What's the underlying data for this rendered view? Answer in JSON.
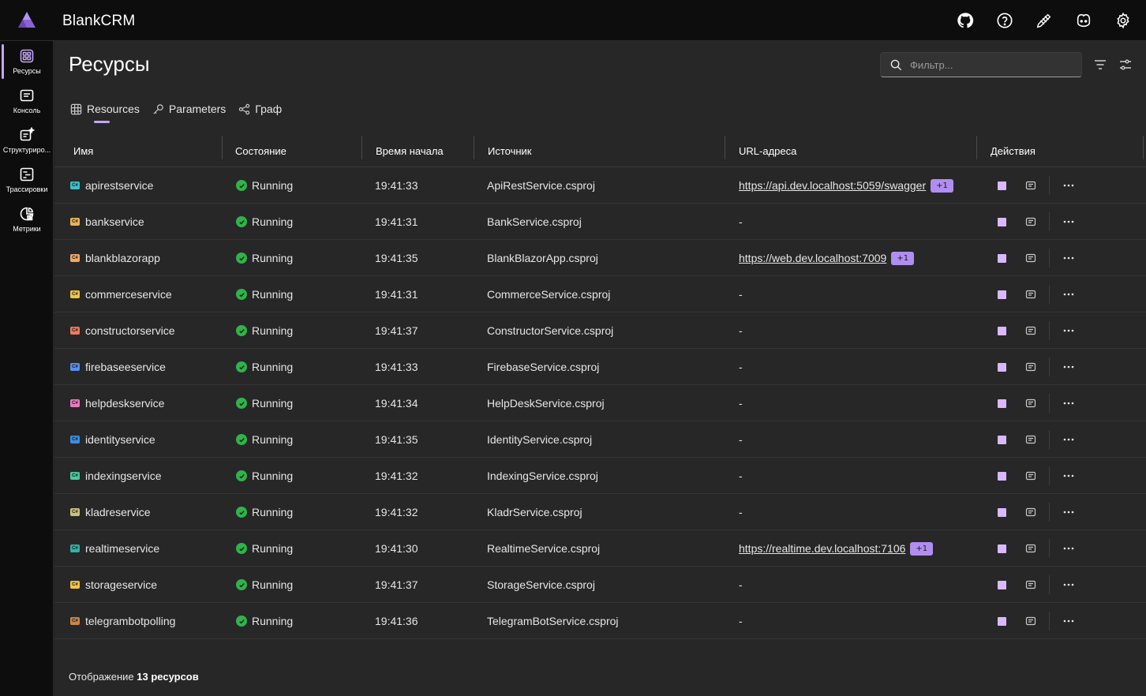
{
  "app": {
    "title": "BlankCRM"
  },
  "nav": [
    {
      "label": "Ресурсы",
      "icon": "grid-icon",
      "active": true
    },
    {
      "label": "Консоль",
      "icon": "console-icon"
    },
    {
      "label": "Структуриро...",
      "icon": "structured-logs-icon"
    },
    {
      "label": "Трассировки",
      "icon": "traces-icon"
    },
    {
      "label": "Метрики",
      "icon": "metrics-icon"
    }
  ],
  "header_icons": [
    "github-icon",
    "help-icon",
    "feedback-icon",
    "copilot-icon",
    "settings-icon"
  ],
  "page": {
    "title": "Ресурсы",
    "filter_placeholder": "Фильтр..."
  },
  "tabs": [
    {
      "label": "Resources",
      "icon": "table-icon",
      "active": true
    },
    {
      "label": "Parameters",
      "icon": "key-icon"
    },
    {
      "label": "Граф",
      "icon": "graph-icon"
    }
  ],
  "columns": {
    "name": "Имя",
    "state": "Состояние",
    "start": "Время начала",
    "source": "Источник",
    "urls": "URL-адреса",
    "actions": "Действия"
  },
  "rows": [
    {
      "name": "apirestservice",
      "color": "#3cc2c9",
      "state": "Running",
      "start": "19:41:33",
      "source": "ApiRestService.csproj",
      "url": "https://api.dev.localhost:5059/swagger",
      "extra": "+1"
    },
    {
      "name": "bankservice",
      "color": "#e8b35a",
      "state": "Running",
      "start": "19:41:31",
      "source": "BankService.csproj",
      "url": "-",
      "extra": ""
    },
    {
      "name": "blankblazorapp",
      "color": "#f0a86a",
      "state": "Running",
      "start": "19:41:35",
      "source": "BlankBlazorApp.csproj",
      "url": "https://web.dev.localhost:7009",
      "extra": "+1"
    },
    {
      "name": "commerceservice",
      "color": "#f5c542",
      "state": "Running",
      "start": "19:41:31",
      "source": "CommerceService.csproj",
      "url": "-",
      "extra": ""
    },
    {
      "name": "constructorservice",
      "color": "#f07a5a",
      "state": "Running",
      "start": "19:41:37",
      "source": "ConstructorService.csproj",
      "url": "-",
      "extra": ""
    },
    {
      "name": "firebaseeservice",
      "color": "#5a8ff0",
      "state": "Running",
      "start": "19:41:33",
      "source": "FirebaseService.csproj",
      "url": "-",
      "extra": ""
    },
    {
      "name": "helpdeskservice",
      "color": "#e87ac0",
      "state": "Running",
      "start": "19:41:34",
      "source": "HelpDeskService.csproj",
      "url": "-",
      "extra": ""
    },
    {
      "name": "identityservice",
      "color": "#3a8ee6",
      "state": "Running",
      "start": "19:41:35",
      "source": "IdentityService.csproj",
      "url": "-",
      "extra": ""
    },
    {
      "name": "indexingservice",
      "color": "#4cc9a0",
      "state": "Running",
      "start": "19:41:32",
      "source": "IndexingService.csproj",
      "url": "-",
      "extra": ""
    },
    {
      "name": "kladreservice",
      "color": "#c8c27a",
      "state": "Running",
      "start": "19:41:32",
      "source": "KladrService.csproj",
      "url": "-",
      "extra": ""
    },
    {
      "name": "realtimeservice",
      "color": "#2fb3a8",
      "state": "Running",
      "start": "19:41:30",
      "source": "RealtimeService.csproj",
      "url": "https://realtime.dev.localhost:7106",
      "extra": "+1"
    },
    {
      "name": "storageservice",
      "color": "#f5c542",
      "state": "Running",
      "start": "19:41:37",
      "source": "StorageService.csproj",
      "url": "-",
      "extra": ""
    },
    {
      "name": "telegrambotpolling",
      "color": "#c9864a",
      "state": "Running",
      "start": "19:41:36",
      "source": "TelegramBotService.csproj",
      "url": "-",
      "extra": ""
    }
  ],
  "footer": {
    "prefix": "Отображение",
    "count": "13 ресурсов"
  }
}
